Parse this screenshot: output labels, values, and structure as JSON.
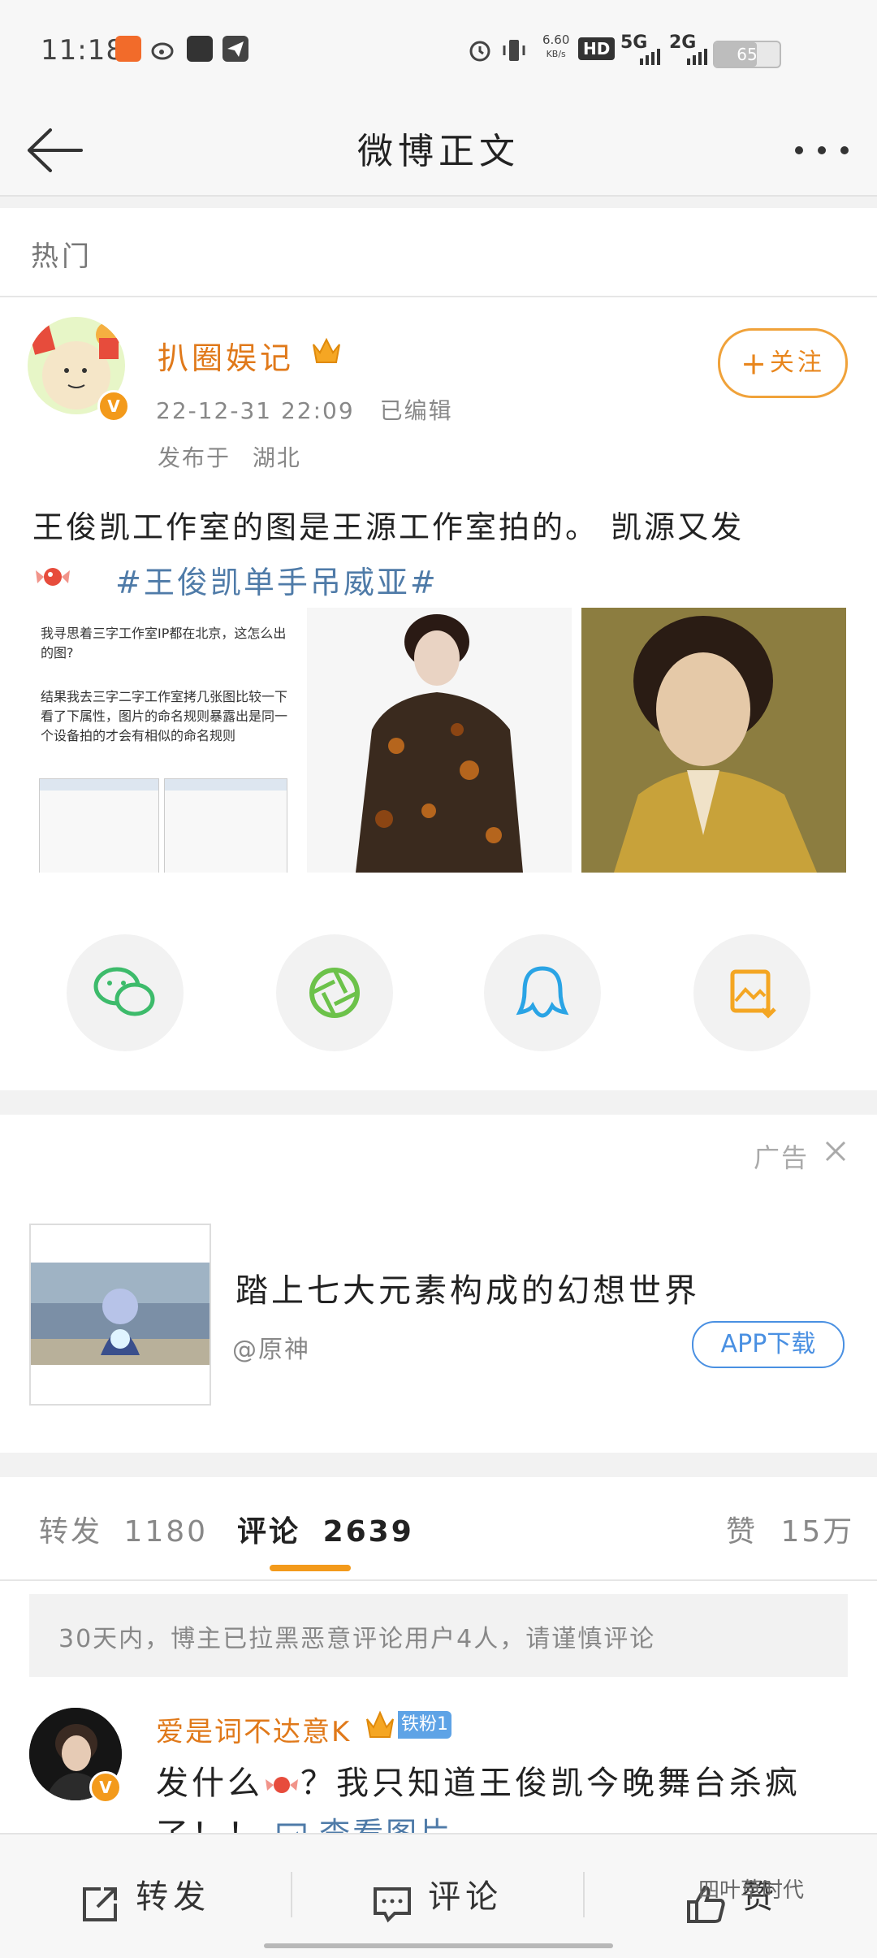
{
  "status_bar": {
    "time": "11:18",
    "network_speed": "6.60",
    "network_unit": "KB/s",
    "hd": "HD",
    "net1": "5G",
    "net2": "2G",
    "battery": "65",
    "battery_level": 0.65
  },
  "header": {
    "title": "微博正文"
  },
  "feed_tab": {
    "label": "热门"
  },
  "post": {
    "author": "扒圈娱记",
    "date": "22-12-31 22:09",
    "edited": "已编辑",
    "location_prefix": "发布于",
    "location": "湖北",
    "follow_label": "关注",
    "text": "王俊凯工作室的图是王源工作室拍的。 凯源又发",
    "topic": "#王俊凯单手吊威亚#",
    "image1_text": "我寻思着三字工作室IP都在北京，这怎么出的图?",
    "image1_text2": "结果我去三字二字工作室拷几张图比较一下看了下属性，图片的命名规则暴露出是同一个设备拍的才会有相似的命名规则"
  },
  "share": {
    "icons": [
      "wechat-icon",
      "moments-icon",
      "qq-icon",
      "save-image-icon"
    ]
  },
  "ad": {
    "label": "广告",
    "title": "踏上七大元素构成的幻想世界",
    "source": "@原神",
    "button": "APP下载"
  },
  "counts": {
    "repost_label": "转发",
    "repost_count": "1180",
    "comment_label": "评论",
    "comment_count": "2639",
    "like_label": "赞",
    "like_count": "15万"
  },
  "notice": {
    "text": "30天内，博主已拉黑恶意评论用户4人，请谨慎评论"
  },
  "comment": {
    "user": "爱是词不达意K",
    "fan_badge": "铁粉1",
    "text_line1_a": "发什么",
    "text_line1_b": "？我只知道王俊凯今晚舞台杀疯",
    "text_line2": "了！！",
    "link": "查看图片"
  },
  "bottom_bar": {
    "repost": "转发",
    "comment": "评论",
    "like": "赞"
  },
  "watermark": "四叶草时代",
  "colors": {
    "accent": "#f39a1b",
    "author": "#e0791a",
    "topic": "#4f7ba8",
    "link_blue": "#4a90e2"
  }
}
